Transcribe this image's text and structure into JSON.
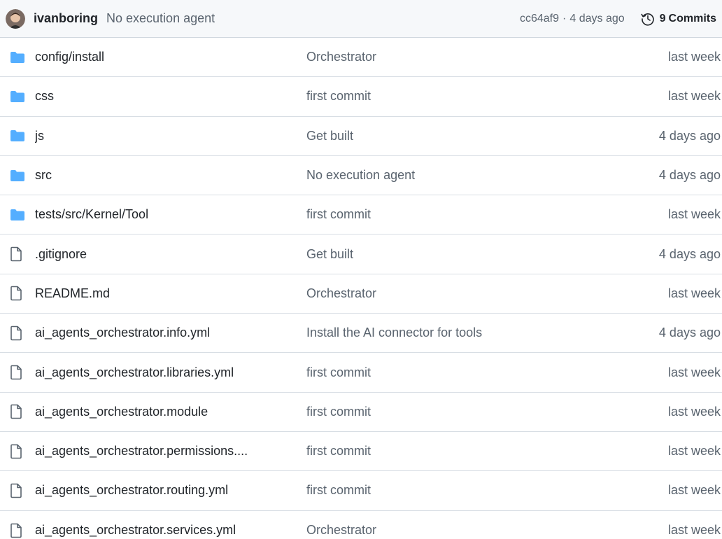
{
  "latest_commit": {
    "author": "ivanboring",
    "message": "No execution agent",
    "sha": "cc64af9",
    "separator": "·",
    "time_ago": "4 days ago",
    "commits_count": "9",
    "commits_label": "Commits",
    "avatar_icon": "user-avatar",
    "history_icon": "history-icon"
  },
  "colors": {
    "folder": "#54aeff",
    "file_outline": "#59636e",
    "header_bg": "#f6f8fa",
    "border": "#d0d7de",
    "text_primary": "#1f2328",
    "text_muted": "#59636e"
  },
  "files": [
    {
      "type": "folder",
      "name": "config/install",
      "message": "Orchestrator",
      "date": "last week"
    },
    {
      "type": "folder",
      "name": "css",
      "message": "first commit",
      "date": "last week"
    },
    {
      "type": "folder",
      "name": "js",
      "message": "Get built",
      "date": "4 days ago"
    },
    {
      "type": "folder",
      "name": "src",
      "message": "No execution agent",
      "date": "4 days ago"
    },
    {
      "type": "folder",
      "name": "tests/src/Kernel/Tool",
      "message": "first commit",
      "date": "last week"
    },
    {
      "type": "file",
      "name": ".gitignore",
      "message": "Get built",
      "date": "4 days ago"
    },
    {
      "type": "file",
      "name": "README.md",
      "message": "Orchestrator",
      "date": "last week"
    },
    {
      "type": "file",
      "name": "ai_agents_orchestrator.info.yml",
      "message": "Install the AI connector for tools",
      "date": "4 days ago"
    },
    {
      "type": "file",
      "name": "ai_agents_orchestrator.libraries.yml",
      "message": "first commit",
      "date": "last week"
    },
    {
      "type": "file",
      "name": "ai_agents_orchestrator.module",
      "message": "first commit",
      "date": "last week"
    },
    {
      "type": "file",
      "name": "ai_agents_orchestrator.permissions....",
      "message": "first commit",
      "date": "last week"
    },
    {
      "type": "file",
      "name": "ai_agents_orchestrator.routing.yml",
      "message": "first commit",
      "date": "last week"
    },
    {
      "type": "file",
      "name": "ai_agents_orchestrator.services.yml",
      "message": "Orchestrator",
      "date": "last week"
    }
  ]
}
